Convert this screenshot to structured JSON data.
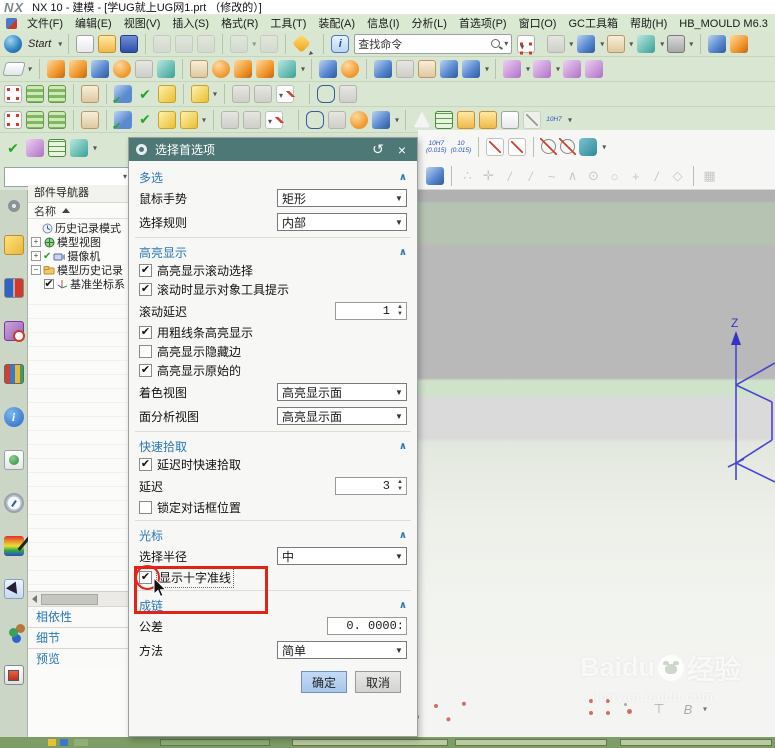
{
  "window": {
    "logo": "NX",
    "title": "NX 10 - 建模 - [学UG就上UG网1.prt （修改的）]"
  },
  "menu": {
    "items": [
      "文件(F)",
      "编辑(E)",
      "视图(V)",
      "插入(S)",
      "格式(R)",
      "工具(T)",
      "装配(A)",
      "信息(I)",
      "分析(L)",
      "首选项(P)",
      "窗口(O)",
      "GC工具箱",
      "帮助(H)",
      "HB_MOULD M6.3"
    ]
  },
  "toolbar": {
    "search": "查找命令"
  },
  "strips": {
    "row1": [
      {
        "k": "globe",
        "n": "start-globe-icon"
      },
      {
        "k": "label",
        "n": "start-button",
        "t": "Start",
        "d": 1
      },
      "|",
      {
        "k": "doc",
        "n": "new-file-icon"
      },
      {
        "k": "folder",
        "n": "open-file-icon"
      },
      {
        "k": "save",
        "n": "save-icon"
      },
      "|",
      {
        "k": "gray",
        "n": "cut-icon",
        "g": 1
      },
      {
        "k": "gray",
        "n": "copy-icon",
        "g": 1
      },
      {
        "k": "gray",
        "n": "paste-icon",
        "g": 1
      },
      "|",
      {
        "k": "gray",
        "n": "undo-icon",
        "d": 1,
        "g": 1
      },
      {
        "k": "gray",
        "n": "redo-icon",
        "g": 1
      },
      "|",
      {
        "k": "star",
        "n": "touch-mode-icon",
        "d": 1
      },
      "|",
      {
        "k": "info",
        "n": "command-finder-icon"
      }
    ],
    "row1R": [
      {
        "k": "fit",
        "n": "fit-view-icon",
        "d": 1
      },
      {
        "k": "gray",
        "n": "render-style-icon",
        "d": 1
      },
      {
        "k": "cube-b",
        "n": "shaded-view-icon",
        "d": 1
      },
      {
        "k": "note",
        "n": "face-edges-icon",
        "d": 1
      },
      {
        "k": "cube-t",
        "n": "background-icon",
        "d": 1
      },
      {
        "k": "win",
        "n": "window-icon",
        "d": 1
      },
      "|",
      {
        "k": "cube-b",
        "n": "export-icon"
      },
      {
        "k": "cube-o",
        "n": "import-icon"
      }
    ],
    "row2": [
      {
        "k": "plane",
        "n": "sketch-icon",
        "d": 1
      },
      "|",
      {
        "k": "cube-o",
        "n": "extrude-icon"
      },
      {
        "k": "cube-o",
        "n": "revolve-icon"
      },
      {
        "k": "cube-b",
        "n": "hole-icon"
      },
      {
        "k": "blob",
        "n": "edge-blend-icon"
      },
      {
        "k": "gray",
        "n": "chamfer-icon"
      },
      {
        "k": "cube-t",
        "n": "shell-icon"
      },
      "|",
      {
        "k": "note",
        "n": "boss-icon"
      },
      {
        "k": "blob",
        "n": "pattern-feature-icon"
      },
      {
        "k": "cube-o",
        "n": "pattern-geometry-icon"
      },
      {
        "k": "cube-o",
        "n": "trim-body-icon"
      },
      {
        "k": "cube-t",
        "n": "unite-icon",
        "d": 1
      },
      "|",
      {
        "k": "cube-b",
        "n": "datum-plane-icon"
      },
      {
        "k": "blob",
        "n": "bell-feature-icon"
      },
      "|",
      {
        "k": "cube-b",
        "n": "bounded-plane-icon"
      },
      {
        "k": "gray",
        "n": "bend-icon"
      },
      {
        "k": "note",
        "n": "thicken-icon"
      },
      {
        "k": "cube-b",
        "n": "pyramid-icon"
      },
      {
        "k": "cube-b",
        "n": "wireframe-cube-icon",
        "d": 1
      },
      "|",
      {
        "k": "cube-p",
        "n": "move-face-icon",
        "d": 1
      },
      {
        "k": "cube-p",
        "n": "delete-face-icon",
        "d": 1
      },
      {
        "k": "cube-p",
        "n": "replace-face-icon"
      },
      {
        "k": "cube-p",
        "n": "offset-region-icon"
      }
    ],
    "row3": [
      {
        "k": "fit",
        "n": "show-and-hide-icon"
      },
      {
        "k": "stack",
        "n": "layer-settings-icon"
      },
      {
        "k": "stack",
        "n": "layer-category-icon"
      },
      "|",
      {
        "k": "note",
        "n": "annotation-icon"
      },
      "|",
      {
        "k": "checkcube",
        "n": "examine-geometry-icon"
      },
      {
        "k": "check",
        "n": "verify-tool-icon"
      },
      {
        "k": "cube-y",
        "n": "check-mate-icon"
      },
      "|",
      {
        "k": "cube-y",
        "n": "text-abc-icon",
        "d": 1
      },
      "|",
      {
        "k": "gray",
        "n": "measure-distance-icon"
      },
      {
        "k": "gray",
        "n": "measure-angle-icon"
      },
      {
        "k": "dim",
        "n": "deviation-gauge-icon",
        "d": 1
      },
      "|",
      {
        "k": "db",
        "n": "expressions-db-icon"
      },
      {
        "k": "gray",
        "n": "hook-icon"
      }
    ],
    "row4": [
      {
        "k": "fit",
        "n": "csys-frame-icon"
      },
      {
        "k": "stack",
        "n": "layer-visible-icon"
      },
      {
        "k": "stack",
        "n": "layer-book-icon"
      },
      "|",
      {
        "k": "note",
        "n": "note2-icon"
      },
      "|",
      {
        "k": "checkcube",
        "n": "check-body-icon"
      },
      {
        "k": "check",
        "n": "check-feature-icon"
      },
      {
        "k": "cube-y",
        "n": "check-section-icon"
      },
      {
        "k": "cube-y",
        "n": "abc-pencil-icon",
        "d": 1
      },
      "|",
      {
        "k": "gray",
        "n": "ruled-surface-icon"
      },
      {
        "k": "gray",
        "n": "swept-surface-icon"
      },
      {
        "k": "dim",
        "n": "part-list-icon",
        "d": 1
      },
      "|",
      {
        "k": "db",
        "n": "database2-icon"
      },
      {
        "k": "gray",
        "n": "spring-icon"
      },
      {
        "k": "blob",
        "n": "donut-icon"
      },
      {
        "k": "cube-b",
        "n": "whisk-tool-icon",
        "d": 1
      },
      "|",
      {
        "k": "tri",
        "n": "draft-analysis-icon"
      },
      {
        "k": "grid",
        "n": "datum-grid-icon"
      },
      {
        "k": "folder",
        "n": "pattern-folder-icon"
      },
      {
        "k": "folder",
        "n": "parts-folder-icon"
      },
      {
        "k": "doc",
        "n": "sheet-list-icon"
      },
      {
        "k": "dim",
        "n": "dim-brush-icon",
        "g": 1
      },
      {
        "k": "tol",
        "n": "fit-tolerance-icon",
        "t": "10H7",
        "d": 1
      }
    ],
    "row5L": [
      {
        "k": "check",
        "n": "finish-sketch-icon"
      },
      {
        "k": "cube-p",
        "n": "sketch-list-icon"
      },
      {
        "k": "grid",
        "n": "sketch-grid-icon"
      },
      {
        "k": "cube-t",
        "n": "orient-csys-icon",
        "d": 1
      }
    ],
    "dim": [
      {
        "k": "tol",
        "n": "hole-tolerance-icon",
        "t": "10H7\n(0.015)"
      },
      {
        "k": "tol",
        "n": "shaft-tolerance-icon",
        "t": "10\n(0.015)"
      },
      "|",
      {
        "k": "dim",
        "n": "radial-leader-icon"
      },
      {
        "k": "dim",
        "n": "radius-dim-icon"
      },
      "|",
      {
        "k": "phi",
        "n": "diameter-dim-icon"
      },
      {
        "k": "phi",
        "n": "diameter-dim2-icon"
      },
      {
        "k": "teal",
        "n": "return-icon",
        "d": 1
      }
    ],
    "snap": [
      {
        "k": "cube-b",
        "n": "work-plane-icon"
      },
      "|",
      {
        "k": "sn",
        "n": "snap-scatter-icon",
        "t": "∴",
        "g": 1
      },
      {
        "k": "sn",
        "n": "snap-move-icon",
        "t": "✛",
        "g": 1
      },
      {
        "k": "sn",
        "n": "snap-end-point-icon",
        "t": "/",
        "g": 1
      },
      {
        "k": "sn",
        "n": "snap-mid-point-icon",
        "t": "/",
        "g": 1
      },
      {
        "k": "sn",
        "n": "snap-curve-icon",
        "t": "~",
        "g": 1
      },
      {
        "k": "sn",
        "n": "snap-spline-pole-icon",
        "t": "∧",
        "g": 1
      },
      {
        "k": "sn",
        "n": "snap-arc-center-icon",
        "t": "⊙",
        "g": 1
      },
      {
        "k": "sn",
        "n": "snap-circle-icon",
        "t": "○",
        "g": 1
      },
      {
        "k": "sn",
        "n": "snap-point-icon",
        "t": "+",
        "g": 1
      },
      {
        "k": "sn",
        "n": "snap-tangent-icon",
        "t": "/",
        "g": 1
      },
      {
        "k": "sn",
        "n": "snap-face-icon",
        "t": "◇",
        "g": 1
      },
      "|",
      {
        "k": "sn",
        "n": "grid-snap-icon",
        "t": "▦",
        "g": 1
      }
    ],
    "res": [
      {
        "k": "r-gear",
        "n": "roles-gear-icon"
      },
      {
        "k": "r-asm",
        "n": "assembly-navigator-icon"
      },
      {
        "k": "r-bow",
        "n": "constraint-navigator-icon"
      },
      {
        "k": "r-hist",
        "n": "part-navigator-icon"
      },
      {
        "k": "r-books",
        "n": "reuse-library-icon"
      },
      {
        "k": "r-info",
        "n": "web-browser-icon"
      },
      {
        "k": "r-doc",
        "n": "history-palette-icon"
      },
      {
        "k": "r-clock",
        "n": "system-clock-icon"
      },
      {
        "k": "r-rain",
        "n": "visual-reports-icon"
      },
      {
        "k": "r-point",
        "n": "selection-wizard-icon"
      },
      {
        "k": "r-ppl",
        "n": "roles-people-icon"
      },
      {
        "k": "r-pane",
        "n": "scene-palette-icon"
      }
    ],
    "sketch": [
      {
        "k": "skk sk-spline skdots",
        "n": "sketch-spline-icon"
      },
      {
        "k": "skk sk-line skdots",
        "n": "sketch-line-icon"
      },
      {
        "k": "skk sk-arc skdots",
        "n": "sketch-arc-icon"
      },
      {
        "k": "skk sk-circle",
        "n": "sketch-circle-icon"
      },
      {
        "k": "skk sk-corner",
        "n": "sketch-fillet-icon"
      },
      {
        "k": "skk sk-corner",
        "n": "sketch-chamfer-icon"
      },
      {
        "k": "skk sk-corner",
        "n": "sketch-corner-icon"
      },
      {
        "k": "skk sk-rect",
        "n": "sketch-rectangle-icon"
      },
      {
        "k": "skk sk-point",
        "n": "sketch-point-icon"
      },
      {
        "k": "skk sk-glyph",
        "n": "sketch-profile-icon",
        "t": "⊤"
      },
      {
        "k": "skk sk-glyph",
        "n": "sketch-b-icon",
        "t": "B",
        "d": 1
      },
      {
        "k": "skk sk-trim",
        "n": "sketch-trim-icon"
      },
      {
        "k": "skk sk-trim",
        "n": "sketch-extend-icon"
      },
      {
        "k": "skk sk-x",
        "n": "sketch-cross-icon"
      }
    ]
  },
  "navigator": {
    "title": "部件导航器",
    "name_col": "名称",
    "tree": {
      "t0": "历史记录模式",
      "t1": "模型视图",
      "t2": "摄像机",
      "t3": "模型历史记录",
      "t4": "基准坐标系"
    },
    "panels": [
      "相依性",
      "细节",
      "预览"
    ]
  },
  "dialog": {
    "title": "选择首选项",
    "multi": {
      "h": "多选",
      "r0l": "鼠标手势",
      "r0v": "矩形",
      "r1l": "选择规则",
      "r1v": "内部"
    },
    "hl": {
      "h": "高亮显示",
      "c0": "高亮显示滚动选择",
      "c1": "滚动时显示对象工具提示",
      "sl": "滚动延迟",
      "sv": "1",
      "c2": "用粗线条高亮显示",
      "c3": "高亮显示隐藏边",
      "c4": "高亮显示原始的",
      "d0l": "着色视图",
      "d0v": "高亮显示面",
      "d1l": "面分析视图",
      "d1v": "高亮显示面"
    },
    "qp": {
      "h": "快速拾取",
      "c0": "延迟时快速拾取",
      "sl": "延迟",
      "sv": "3",
      "c1": "锁定对话框位置"
    },
    "cur": {
      "h": "光标",
      "d0l": "选择半径",
      "d0v": "中",
      "c0": "显示十字准线"
    },
    "ch": {
      "h": "成链",
      "tl": "公差",
      "tv": "0. 0000:",
      "d0l": "方法",
      "d0v": "简单"
    },
    "checks": {
      "hl0": true,
      "hl1": true,
      "hl2": true,
      "hl3": false,
      "hl4": true,
      "qp0": true,
      "qp1": false,
      "cur0": true
    },
    "ok": "确定",
    "cancel": "取消"
  },
  "graphics": {
    "z": "Z"
  },
  "watermark": {
    "brand": "Baidu",
    "suffix": "经验",
    "url": "jingyan.baidu.com"
  },
  "accent": {
    "dialog_header": "#4d7876",
    "section_blue": "#2878b8",
    "annotation_red": "#e42318",
    "menu_green": "#d9e9d2"
  }
}
